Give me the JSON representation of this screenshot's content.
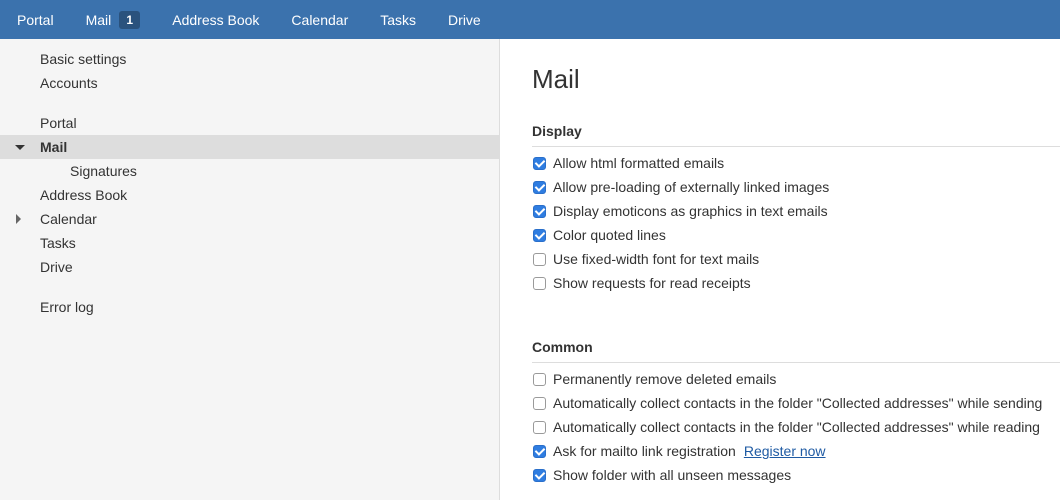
{
  "topnav": {
    "items": [
      {
        "label": "Portal"
      },
      {
        "label": "Mail",
        "badge": "1"
      },
      {
        "label": "Address Book"
      },
      {
        "label": "Calendar"
      },
      {
        "label": "Tasks"
      },
      {
        "label": "Drive"
      }
    ]
  },
  "sidebar": {
    "items": [
      {
        "label": "Basic settings"
      },
      {
        "label": "Accounts"
      },
      {
        "label": "Portal"
      },
      {
        "label": "Mail",
        "expanded": true,
        "selected": true
      },
      {
        "label": "Signatures"
      },
      {
        "label": "Address Book"
      },
      {
        "label": "Calendar",
        "expandable": true
      },
      {
        "label": "Tasks"
      },
      {
        "label": "Drive"
      },
      {
        "label": "Error log"
      }
    ]
  },
  "main": {
    "title": "Mail",
    "display": {
      "title": "Display",
      "options": [
        {
          "label": "Allow html formatted emails",
          "checked": true
        },
        {
          "label": "Allow pre-loading of externally linked images",
          "checked": true
        },
        {
          "label": "Display emoticons as graphics in text emails",
          "checked": true
        },
        {
          "label": "Color quoted lines",
          "checked": true
        },
        {
          "label": "Use fixed-width font for text mails",
          "checked": false
        },
        {
          "label": "Show requests for read receipts",
          "checked": false
        }
      ]
    },
    "common": {
      "title": "Common",
      "options": [
        {
          "label": "Permanently remove deleted emails",
          "checked": false
        },
        {
          "label": "Automatically collect contacts in the folder \"Collected addresses\" while sending",
          "checked": false
        },
        {
          "label": "Automatically collect contacts in the folder \"Collected addresses\" while reading",
          "checked": false
        },
        {
          "label": "Ask for mailto link registration",
          "checked": true,
          "link": "Register now"
        },
        {
          "label": "Show folder with all unseen messages",
          "checked": true
        }
      ]
    }
  },
  "colors": {
    "topbar": "#3b72ad",
    "sidebar": "#f5f5f5",
    "selected_row": "#dddddd",
    "checkbox_checked": "#2f7de1",
    "link": "#1e5aa3"
  }
}
